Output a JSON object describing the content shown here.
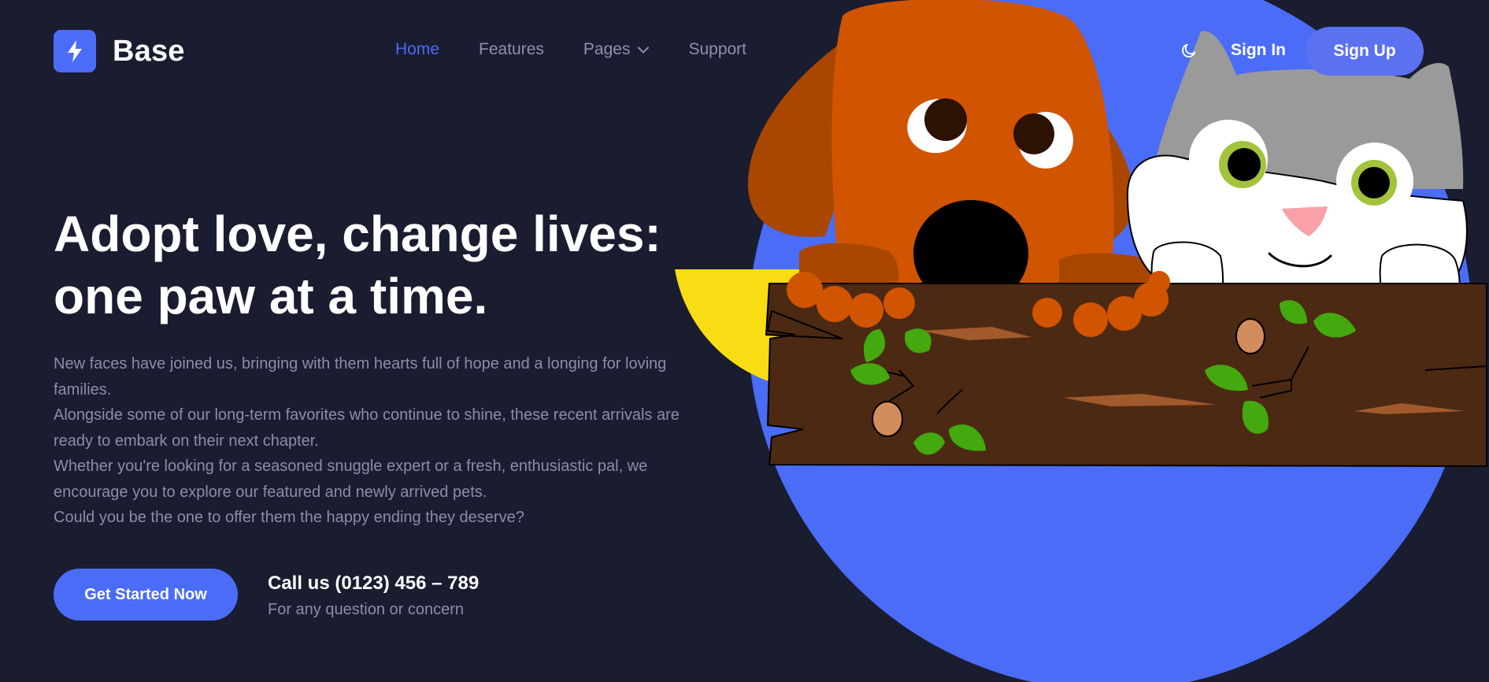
{
  "brand": {
    "name": "Base",
    "accent_color": "#4a6cf7",
    "background_color": "#1a1c30",
    "logo_icon": "lightning-bolt-icon"
  },
  "nav": {
    "items": [
      {
        "label": "Home",
        "active": true
      },
      {
        "label": "Features",
        "active": false
      },
      {
        "label": "Pages",
        "active": false,
        "has_dropdown": true
      },
      {
        "label": "Support",
        "active": false
      }
    ]
  },
  "header_actions": {
    "theme_icon": "moon-icon",
    "sign_in": "Sign In",
    "sign_up": "Sign Up"
  },
  "hero": {
    "title_line1": "Adopt love, change lives:",
    "title_line2": "one paw at a time.",
    "paragraphs": [
      "New faces have joined us, bringing with them hearts full of hope and a longing for loving families.",
      "Alongside some of our long-term favorites who continue to shine, these recent arrivals are ready to embark on their next chapter.",
      "Whether you're looking for a seasoned snuggle expert or a fresh, enthusiastic pal, we encourage you to explore our featured and newly arrived pets.",
      "Could you be the one to offer them the happy ending they deserve?"
    ],
    "cta_label": "Get Started Now",
    "call_title": "Call us (0123) 456 – 789",
    "call_subtitle": "For any question or concern"
  }
}
